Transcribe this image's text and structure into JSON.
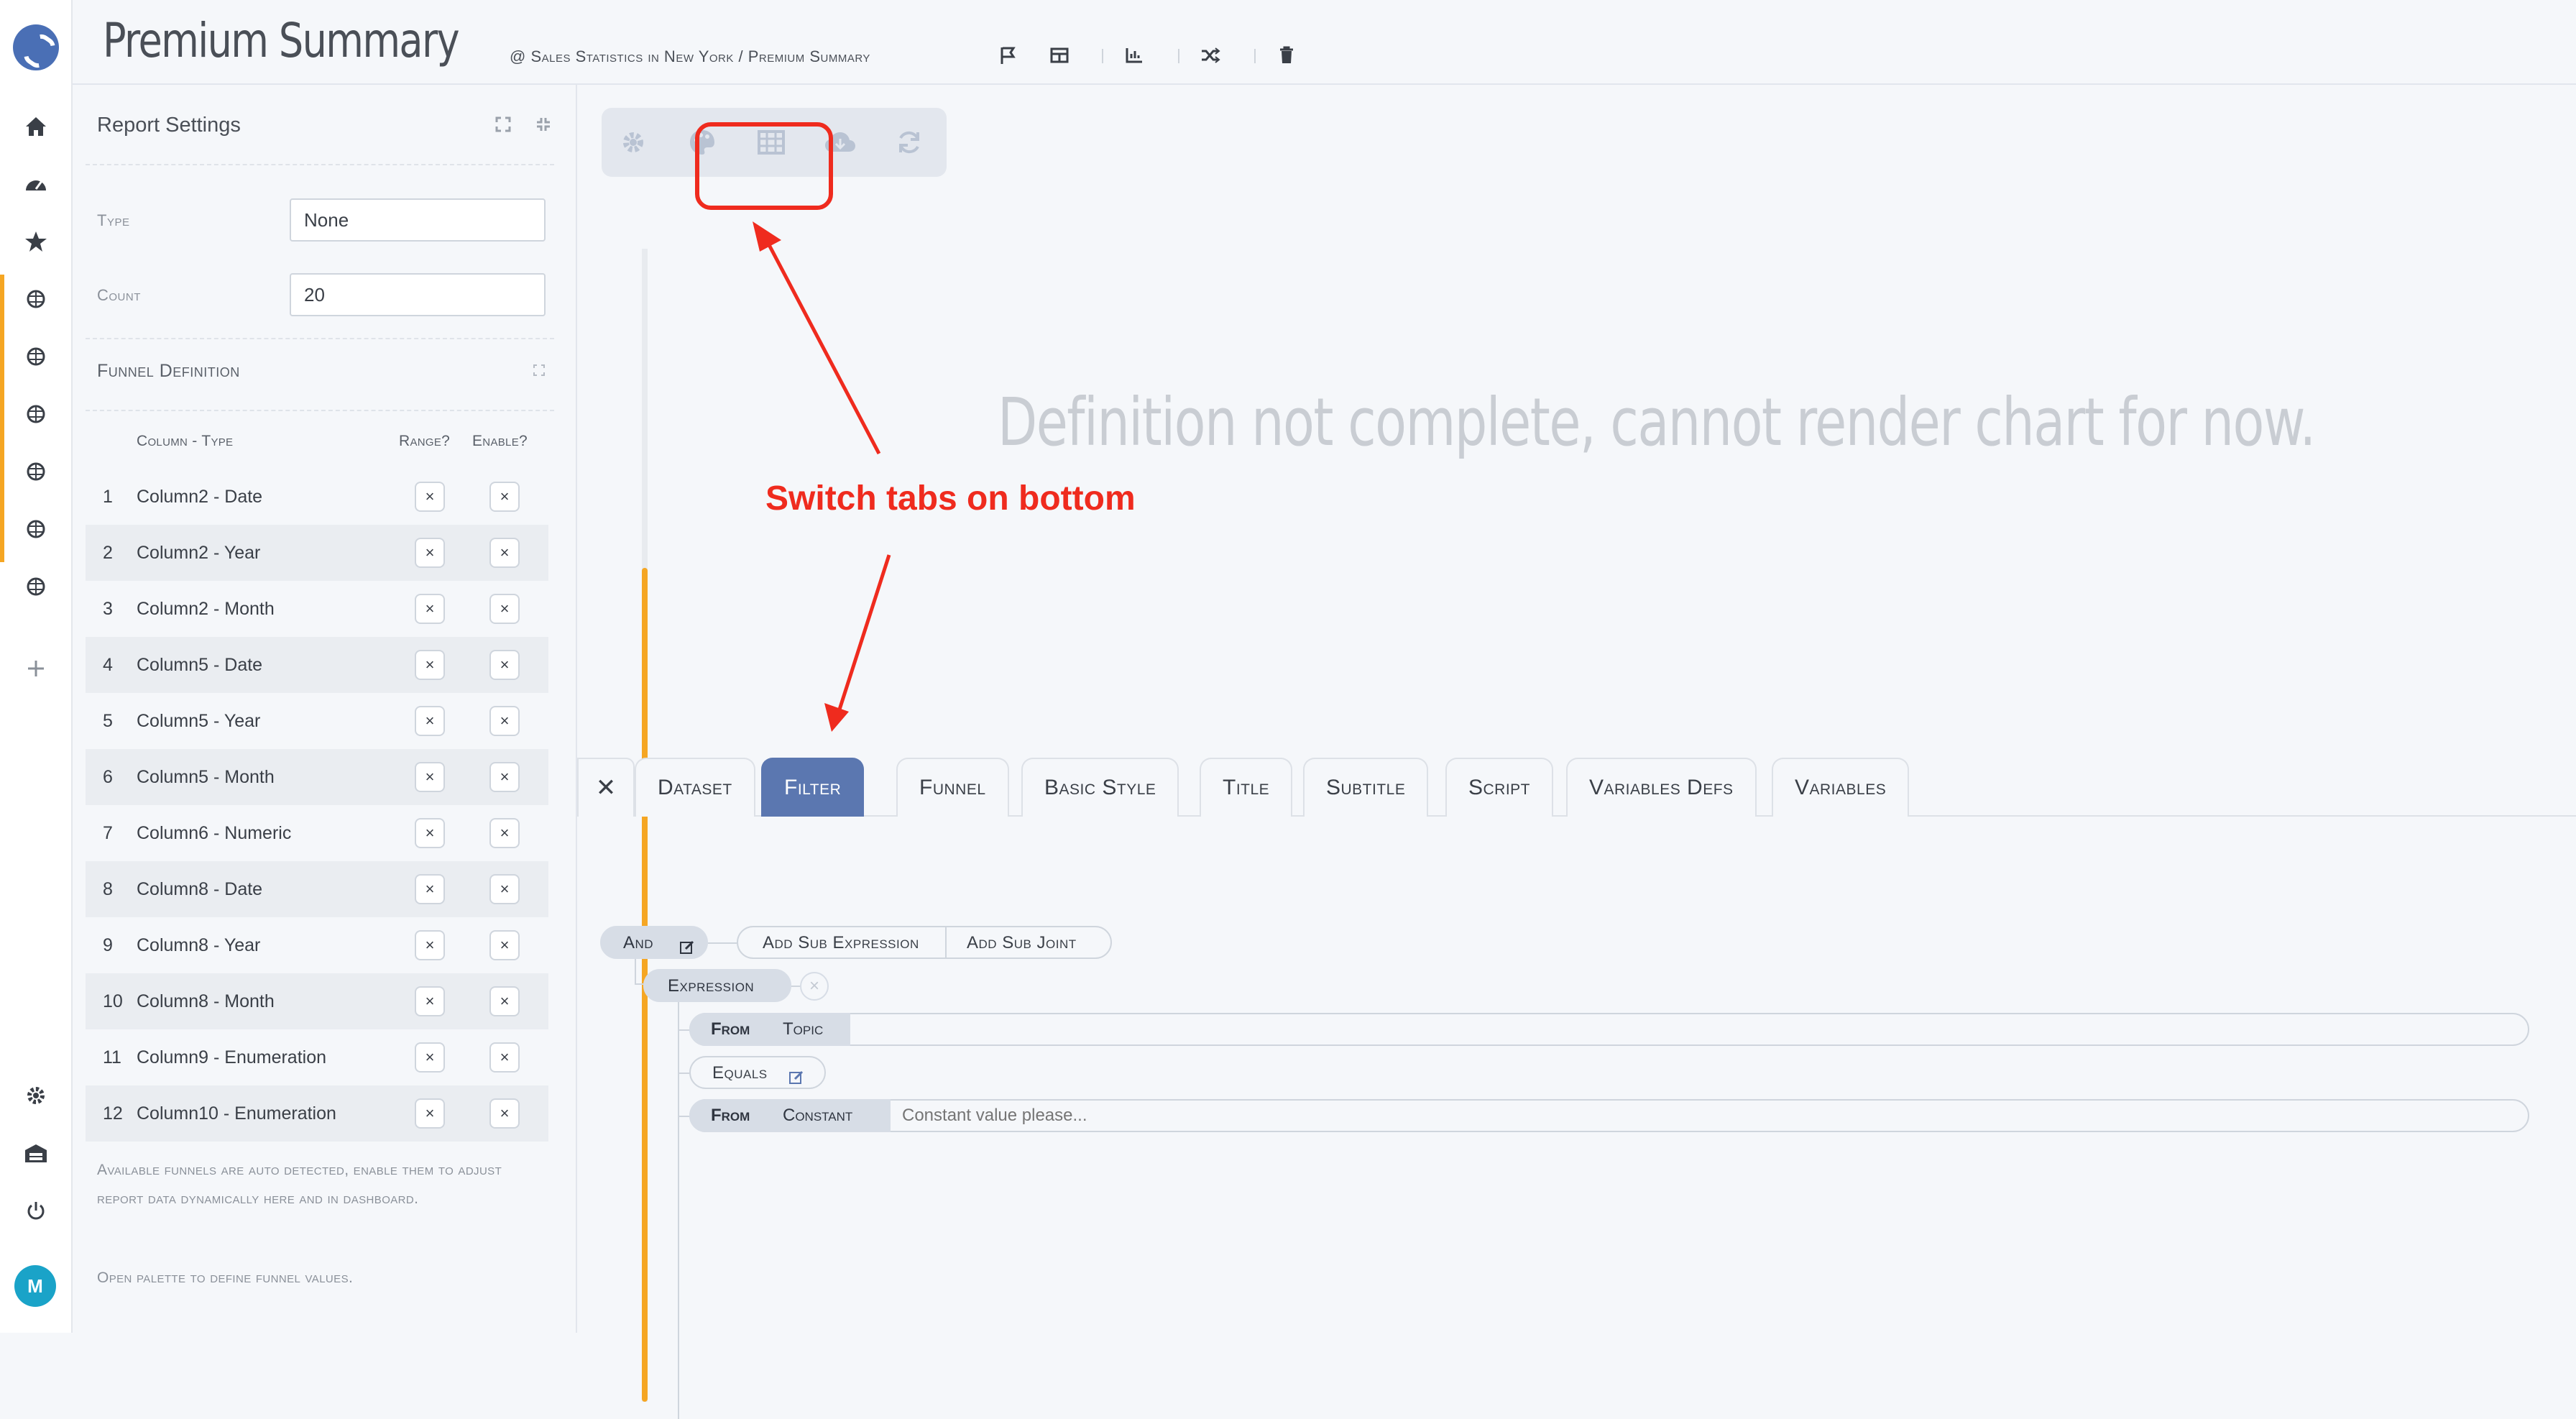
{
  "header": {
    "title": "Premium Summary",
    "breadcrumb": "@ Sales Statistics in New York / Premium Summary",
    "tools": [
      "flag-icon",
      "table-icon",
      "chart-axis-icon",
      "shuffle-icon",
      "trash-icon"
    ]
  },
  "nav": {
    "logo": "logo-icon",
    "top_items": [
      "home-icon",
      "dashboard-gauge-icon",
      "star-icon",
      "report-icon",
      "report-icon",
      "report-icon",
      "report-icon",
      "report-icon",
      "report-icon"
    ],
    "add": "plus-icon",
    "bottom_items": [
      "gear-icon",
      "warehouse-icon",
      "power-icon"
    ],
    "avatar": "M",
    "avatar_color": "#1aa3c8"
  },
  "panel": {
    "title": "Report Settings",
    "type_label": "Type",
    "type_value": "None",
    "count_label": "Count",
    "count_value": "20",
    "funnel_title": "Funnel Definition",
    "col_header": "Column - Type",
    "range_header": "Range?",
    "enable_header": "Enable?",
    "rows": [
      {
        "idx": "1",
        "label": "Column2 - Date"
      },
      {
        "idx": "2",
        "label": "Column2 - Year"
      },
      {
        "idx": "3",
        "label": "Column2 - Month"
      },
      {
        "idx": "4",
        "label": "Column5 - Date"
      },
      {
        "idx": "5",
        "label": "Column5 - Year"
      },
      {
        "idx": "6",
        "label": "Column5 - Month"
      },
      {
        "idx": "7",
        "label": "Column6 - Numeric"
      },
      {
        "idx": "8",
        "label": "Column8 - Date"
      },
      {
        "idx": "9",
        "label": "Column8 - Year"
      },
      {
        "idx": "10",
        "label": "Column8 - Month"
      },
      {
        "idx": "11",
        "label": "Column9 - Enumeration"
      },
      {
        "idx": "12",
        "label": "Column10 - Enumeration"
      }
    ],
    "check_mark": "×",
    "note1": "Available funnels are auto detected, enable them to adjust report data dynamically here and in dashboard.",
    "note2": "Open palette to define funnel values."
  },
  "main": {
    "placeholder": "Definition not complete, cannot render chart for now.",
    "annotation": "Switch  tabs on bottom",
    "annotation_color": "#ef2b1e",
    "toolbar": [
      "gear-icon",
      "palette-icon",
      "grid-icon",
      "cloud-download-icon",
      "refresh-icon"
    ]
  },
  "tabs": {
    "close": "✕",
    "items": [
      "Dataset",
      "Filter",
      "Funnel",
      "Basic Style",
      "Title",
      "Subtitle",
      "Script",
      "Variables Defs",
      "Variables"
    ],
    "active": "Filter",
    "active_color": "#5b77b0"
  },
  "filter": {
    "joint": "And",
    "add_sub_expression": "Add Sub Expression",
    "add_sub_joint": "Add Sub Joint",
    "expression": "Expression",
    "remove": "×",
    "from1": "From",
    "topic": "Topic",
    "operator": "Equals",
    "from2": "From",
    "constant": "Constant",
    "constant_placeholder": "Constant value please..."
  }
}
